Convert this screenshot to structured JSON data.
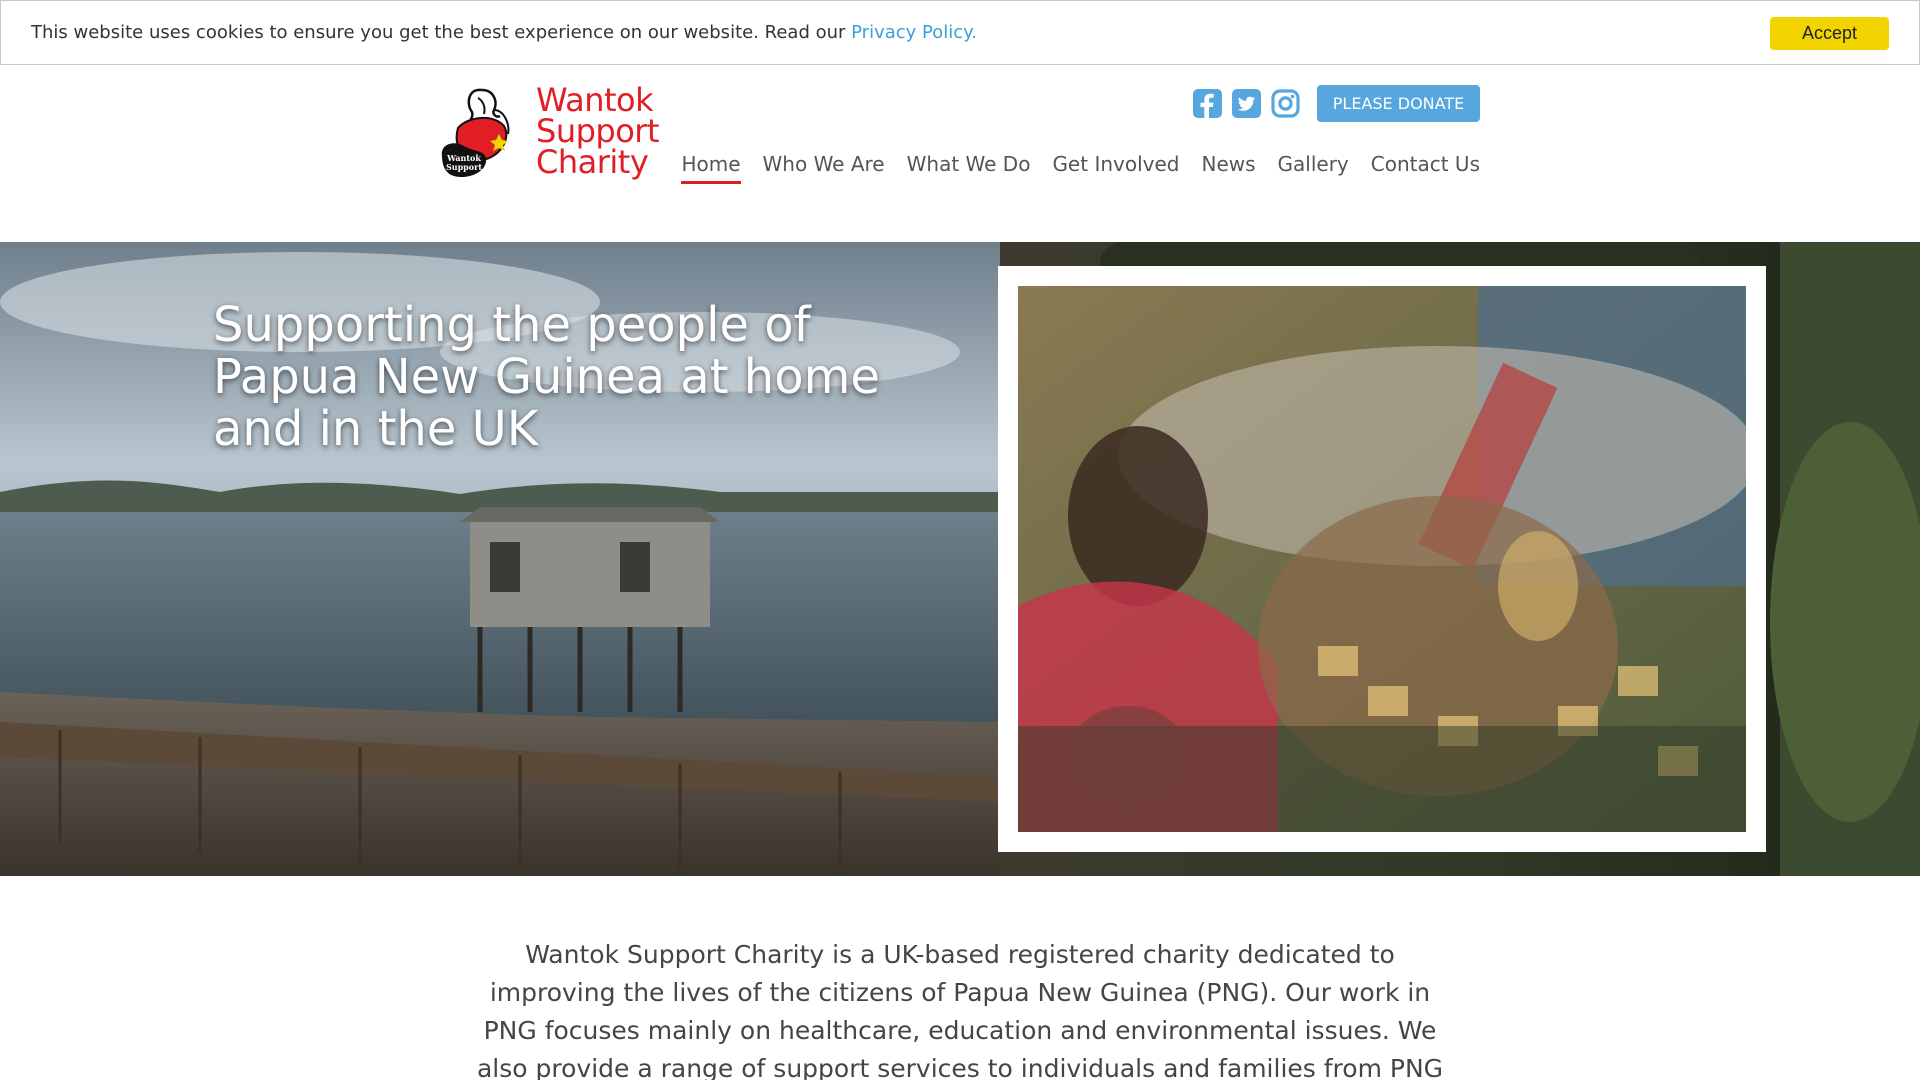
{
  "cookie": {
    "text": "This website uses cookies to ensure you get the best experience on our website. Read our ",
    "link_label": "Privacy Policy.",
    "accept_label": "Accept"
  },
  "brand": {
    "name_lines": [
      "Wantok",
      "Support",
      "Charity"
    ],
    "badge_text_1": "Wantok",
    "badge_text_2": "Support",
    "color": "#e11e25"
  },
  "social": [
    {
      "icon": "facebook-icon",
      "color": "#58a6de"
    },
    {
      "icon": "twitter-icon",
      "color": "#58a6de"
    },
    {
      "icon": "instagram-icon",
      "color": "#58a6de"
    }
  ],
  "donate_label": "PLEASE DONATE",
  "nav": {
    "items": [
      {
        "label": "Home",
        "active": true
      },
      {
        "label": "Who We Are",
        "active": false
      },
      {
        "label": "What We Do",
        "active": false
      },
      {
        "label": "Get Involved",
        "active": false
      },
      {
        "label": "News",
        "active": false
      },
      {
        "label": "Gallery",
        "active": false
      },
      {
        "label": "Contact Us",
        "active": false
      }
    ]
  },
  "hero": {
    "title": "Supporting the people of Papua New Guinea at home and in the UK"
  },
  "intro": {
    "text": "Wantok Support Charity is a UK-based registered charity dedicated to improving the lives of the citizens of Papua New Guinea (PNG). Our work in PNG focuses mainly on healthcare, education and environmental issues. We also provide a range of support services to individuals and families from PNG who have settled in the UK."
  },
  "colors": {
    "accent_red": "#e11e25",
    "accent_blue": "#58a6de",
    "accept_yellow": "#f2d400",
    "link_blue": "#3aa0d8"
  }
}
